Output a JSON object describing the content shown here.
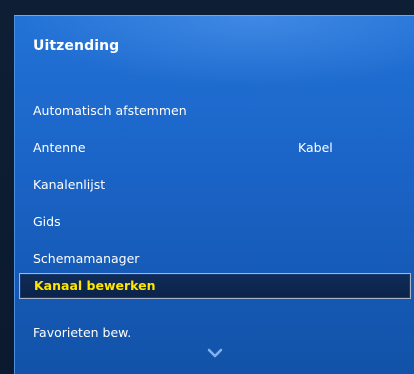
{
  "menu": {
    "title": "Uitzending",
    "items": [
      {
        "label": "Automatisch afstemmen"
      },
      {
        "label": "Antenne",
        "value": "Kabel"
      },
      {
        "label": "Kanalenlijst"
      },
      {
        "label": "Gids"
      },
      {
        "label": "Schemamanager"
      },
      {
        "label": "Kanaal bewerken",
        "selected": true
      },
      {
        "label": "Favorieten bew."
      }
    ],
    "scroll_indicator": "chevron-down-icon"
  },
  "colors": {
    "panel": "#1a63c6",
    "selected_background": "#0b234a",
    "selected_text": "#ffe600",
    "text": "#ffffff"
  }
}
